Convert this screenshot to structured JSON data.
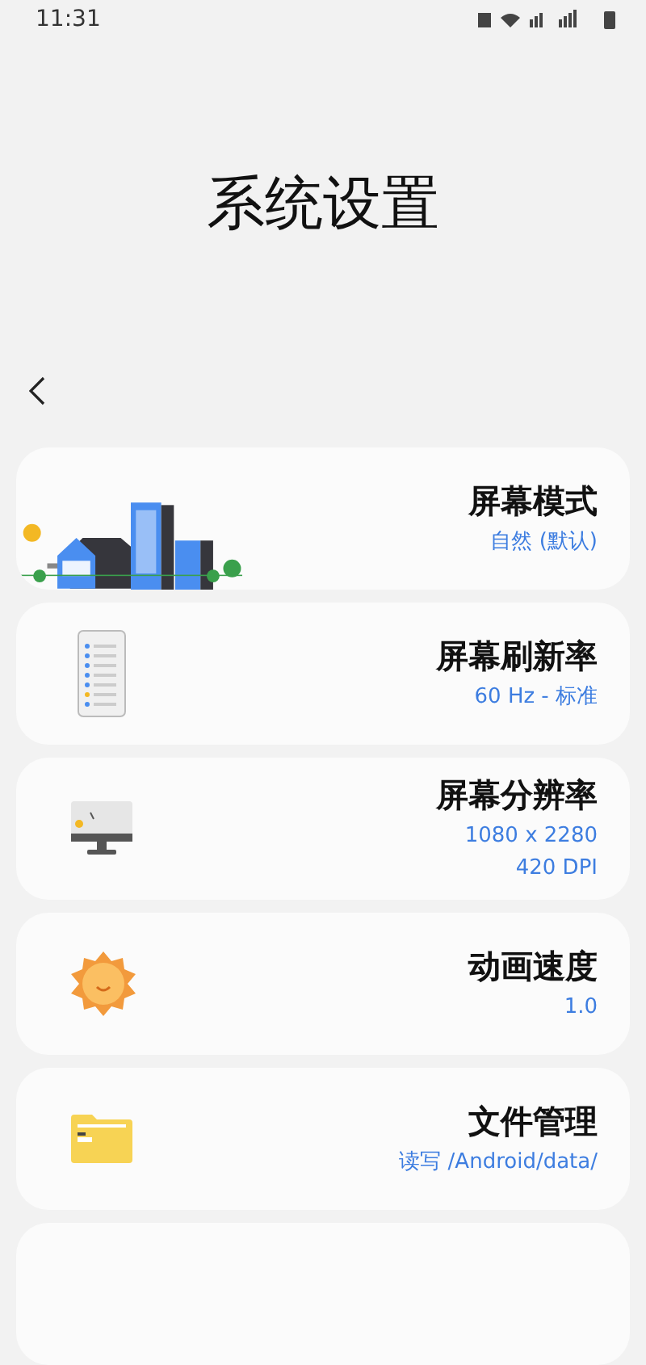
{
  "status_bar": {
    "time": "11:31"
  },
  "title": "系统设置",
  "items": [
    {
      "title": "屏幕模式",
      "values": [
        "自然 (默认)"
      ]
    },
    {
      "title": "屏幕刷新率",
      "values": [
        "60 Hz - 标准"
      ]
    },
    {
      "title": "屏幕分辨率",
      "values": [
        "1080 x 2280",
        "420 DPI"
      ]
    },
    {
      "title": "动画速度",
      "values": [
        "1.0"
      ]
    },
    {
      "title": "文件管理",
      "values": [
        "读写 /Android/data/"
      ]
    }
  ]
}
